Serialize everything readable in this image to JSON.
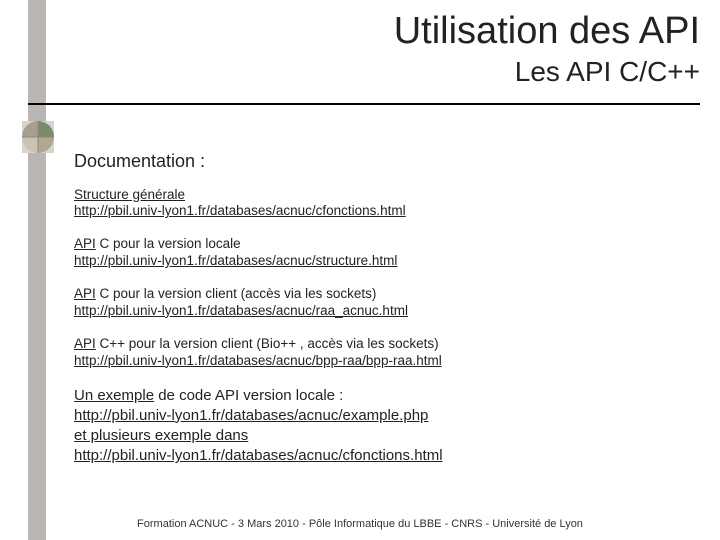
{
  "title": "Utilisation des API",
  "subtitle": "Les API C/C++",
  "heading": "Documentation :",
  "blocks": {
    "structure": {
      "label": "Structure générale",
      "url": "http://pbil.univ-lyon1.fr/databases/acnuc/cfonctions.html"
    },
    "api_local": {
      "prefix": "API",
      "rest": " C pour la version locale",
      "url": "http://pbil.univ-lyon1.fr/databases/acnuc/structure.html"
    },
    "api_client_c": {
      "prefix": "API",
      "rest": " C pour la version client (accès via les sockets)",
      "url": "http://pbil.univ-lyon1.fr/databases/acnuc/raa_acnuc.html"
    },
    "api_client_cpp": {
      "prefix": "API",
      "rest": " C++ pour la version client (Bio++ , accès via les sockets)",
      "url": "http://pbil.univ-lyon1.fr/databases/acnuc/bpp-raa/bpp-raa.html"
    },
    "example": {
      "prefix": "Un exemple",
      "rest": " de code API version locale :",
      "url1": "http://pbil.univ-lyon1.fr/databases/acnuc/example.php",
      "mid": "et plusieurs exemple dans",
      "url2": "http://pbil.univ-lyon1.fr/databases/acnuc/cfonctions.html"
    }
  },
  "footer": "Formation ACNUC - 3 Mars 2010 - Pôle Informatique du LBBE - CNRS - Université de Lyon"
}
